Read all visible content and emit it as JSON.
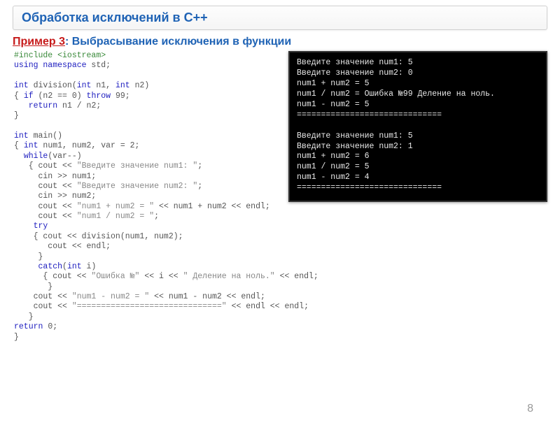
{
  "header": {
    "title": "Обработка исключений в С++"
  },
  "subtitle": {
    "label": "Пример 3",
    "sep": ": ",
    "desc": "Выбрасывание исключения в функции"
  },
  "code": {
    "l01a": "#include ",
    "l01b": "<iostream>",
    "l02a": "using namespace",
    "l02b": " std;",
    "l03": "",
    "l04a": "int",
    "l04b": " division(",
    "l04c": "int",
    "l04d": " n1, ",
    "l04e": "int",
    "l04f": " n2)",
    "l05a": "{ ",
    "l05b": "if",
    "l05c": " (n2 == 0) ",
    "l05d": "throw",
    "l05e": " 99;",
    "l06a": "   ",
    "l06b": "return",
    "l06c": " n1 / n2;",
    "l07": "}",
    "l08": "",
    "l09a": "int",
    "l09b": " main()",
    "l10a": "{ ",
    "l10b": "int",
    "l10c": " num1, num2, var = 2;",
    "l11a": "  ",
    "l11b": "while",
    "l11c": "(var--)",
    "l12a": "   { cout << ",
    "l12b": "\"Введите значение num1: \"",
    "l12c": ";",
    "l13": "     cin >> num1;",
    "l14a": "     cout << ",
    "l14b": "\"Введите значение num2: \"",
    "l14c": ";",
    "l15": "     cin >> num2;",
    "l16a": "     cout << ",
    "l16b": "\"num1 + num2 = \"",
    "l16c": " << num1 + num2 << endl;",
    "l17a": "     cout << ",
    "l17b": "\"num1 / num2 = \"",
    "l17c": ";",
    "l18a": "    ",
    "l18b": "try",
    "l19": "    { cout << division(num1, num2);",
    "l20": "       cout << endl;",
    "l21": "     }",
    "l22a": "     ",
    "l22b": "catch",
    "l22c": "(",
    "l22d": "int",
    "l22e": " i)",
    "l23a": "      { cout << ",
    "l23b": "\"Ошибка №\"",
    "l23c": " << i << ",
    "l23d": "\" Деление на ноль.\"",
    "l23e": " << endl;",
    "l24": "       }",
    "l25a": "    cout << ",
    "l25b": "\"num1 - num2 = \"",
    "l25c": " << num1 - num2 << endl;",
    "l26a": "    cout << ",
    "l26b": "\"==============================\"",
    "l26c": " << endl << endl;",
    "l27": "   }",
    "l28a": "return",
    "l28b": " 0;",
    "l29": "}"
  },
  "console": {
    "lines": [
      "Введите значение num1: 5",
      "Введите значение num2: 0",
      "num1 + num2 = 5",
      "num1 / num2 = Ошибка №99 Деление на ноль.",
      "num1 - num2 = 5",
      "==============================",
      "",
      "Введите значение num1: 5",
      "Введите значение num2: 1",
      "num1 + num2 = 6",
      "num1 / num2 = 5",
      "num1 - num2 = 4",
      "=============================="
    ]
  },
  "page": "8"
}
